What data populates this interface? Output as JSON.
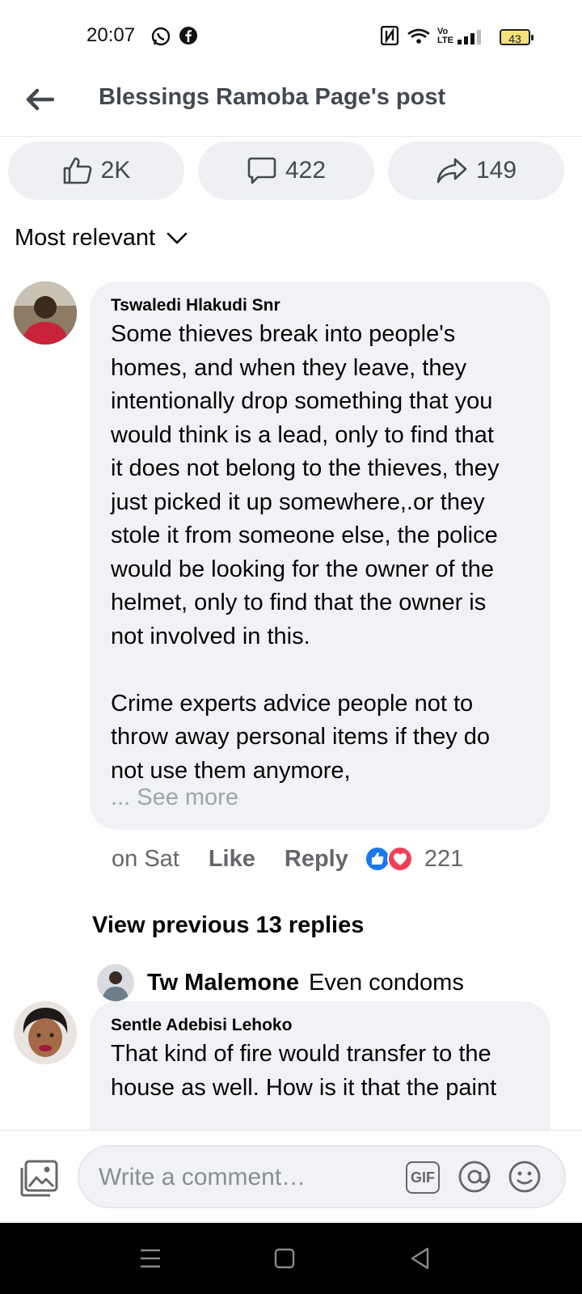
{
  "status_bar": {
    "time": "20:07",
    "battery": "43",
    "network_label": "Vo LTE",
    "icons": [
      "whatsapp-icon",
      "facebook-icon",
      "nfc-icon",
      "wifi-icon",
      "volte-icon",
      "signal-icon",
      "battery-icon"
    ]
  },
  "header": {
    "title": "Blessings Ramoba Page's post",
    "back_icon": "back-arrow-icon"
  },
  "reactions_summary": {
    "likes": "2K",
    "comments": "422",
    "shares": "149"
  },
  "sort": {
    "label": "Most relevant"
  },
  "comments": [
    {
      "author": "Tswaledi Hlakudi Snr",
      "text": "Some thieves break into people's\nhomes, and when they leave, they\nintentionally drop something that you\nwould think is a lead, only to find that\nit does not belong to the thieves, they\njust picked it up somewhere,.or they\nstole it from someone else, the police\nwould be looking for the owner of the\nhelmet, only to find that the owner is\nnot involved in this.\n\nCrime experts advice people not to\nthrow away personal items if they do\nnot use them anymore,",
      "see_more": "... See more",
      "time": "on Sat",
      "like_label": "Like",
      "reply_label": "Reply",
      "reaction_count": "221",
      "view_previous": "View previous 13 replies",
      "reply_preview": {
        "author": "Tw Malemone",
        "text": "Even condoms"
      }
    },
    {
      "author": "Sentle Adebisi Lehoko",
      "text": "That kind of fire would transfer to the\nhouse as well. How is it that the paint"
    }
  ],
  "composer": {
    "placeholder": "Write a comment…",
    "gif_label": "GIF"
  },
  "colors": {
    "like_blue": "#1877f2",
    "love_red": "#f33e58",
    "bubble_gray": "#f0f2f5"
  }
}
